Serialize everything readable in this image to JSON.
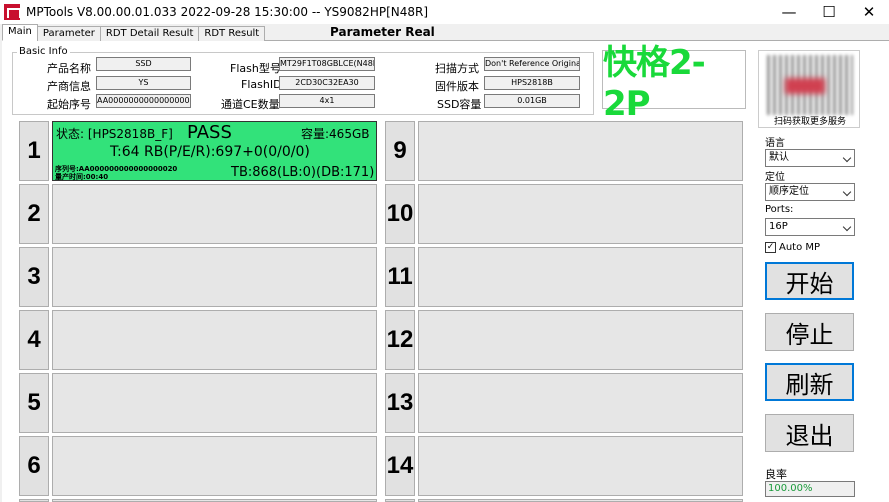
{
  "window": {
    "title": "MPTools V8.00.00.01.033 2022-09-28 15:30:00  -- YS9082HP[N48R]",
    "minimize": "—",
    "maximize": "☐",
    "close": "✕"
  },
  "tabs": [
    "Main",
    "Parameter",
    "RDT Detail Result",
    "RDT Result"
  ],
  "header_center": "Parameter  Real",
  "basic_info": {
    "title": "Basic Info",
    "product_name_label": "产品名称",
    "product_name": "SSD",
    "vendor_label": "产商信息",
    "vendor": "YS",
    "start_sn_label": "起始序号",
    "start_sn": "AA000000000000000020",
    "flash_type_label": "Flash型号",
    "flash_type": "MT29F1T08GBLCE(N48R",
    "flash_id_label": "FlashID",
    "flash_id": "2CD30C32EA30",
    "ce_count_label": "通道CE数量",
    "ce_count": "4x1",
    "scan_mode_label": "扫描方式",
    "scan_mode": "Don't Reference Original",
    "firmware_label": "固件版本",
    "firmware": "HPS2818B",
    "capacity_label": "SSD容量",
    "capacity": "0.01GB"
  },
  "big_title": "快格2-2P",
  "qr_caption": "扫码获取更多服务",
  "ports_left": [
    "1",
    "2",
    "3",
    "4",
    "5",
    "6"
  ],
  "ports_right": [
    "9",
    "10",
    "11",
    "12",
    "13",
    "14"
  ],
  "port1": {
    "status": "状态: [HPS2818B_F]",
    "result": "PASS",
    "capacity": "容量:465GB",
    "rb": "T:64 RB(P/E/R):697+0(0/0/0)",
    "sn": "序列号:AA000000000000000020",
    "time": "量产时间:00:40",
    "tb": "TB:868(LB:0)(DB:171)",
    "color": "#32e27a"
  },
  "controls": {
    "language_label": "语言",
    "language_value": "默认",
    "locate_label": "定位",
    "locate_value": "顺序定位",
    "ports_label": "Ports:",
    "ports_value": "16P",
    "auto_mp_label": "Auto MP",
    "auto_mp_checked": "✓",
    "start_label": "开始",
    "stop_label": "停止",
    "refresh_label": "刷新",
    "exit_label": "退出",
    "yield_label": "良率",
    "yield_value": "100.00%"
  }
}
